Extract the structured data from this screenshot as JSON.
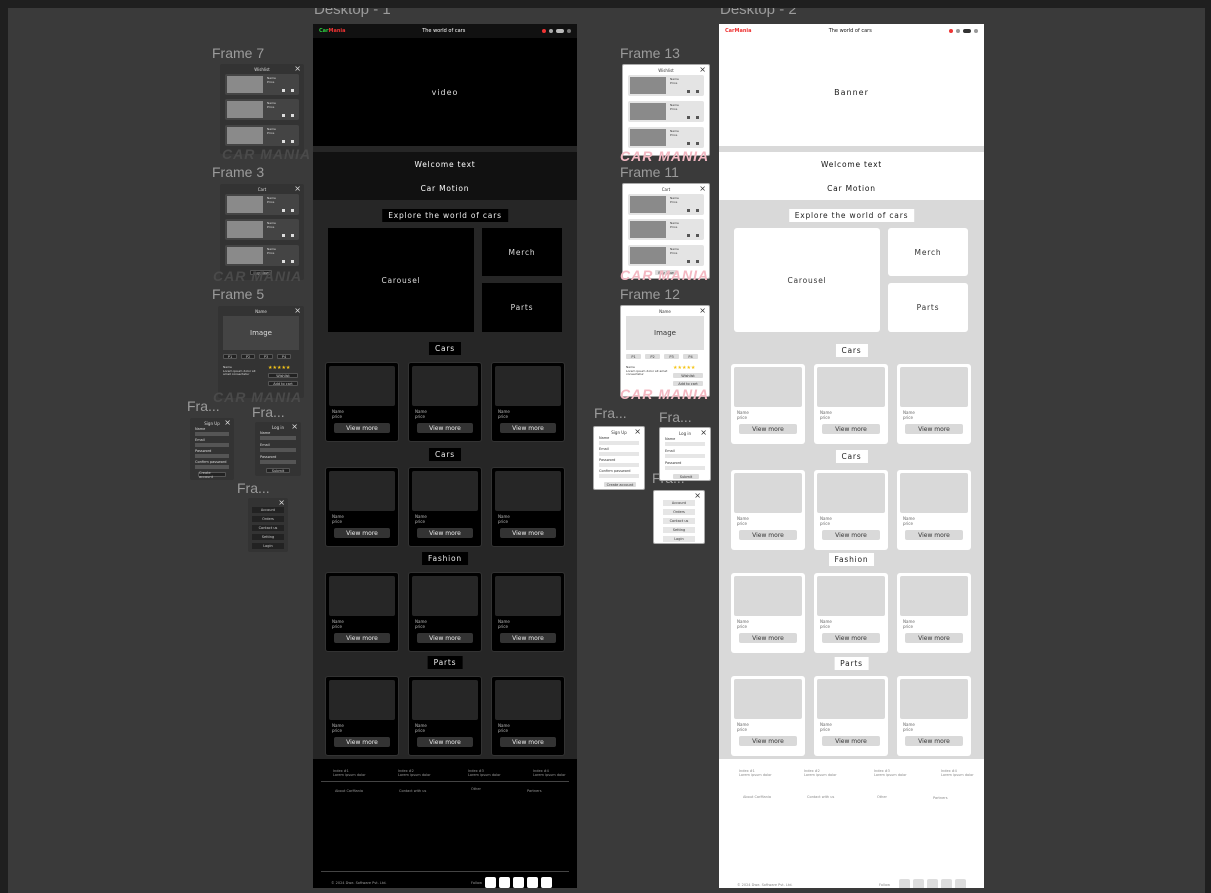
{
  "desktops": {
    "d1": {
      "label": "Desktop - 1"
    },
    "d2": {
      "label": "Desktop - 2"
    }
  },
  "topbar": {
    "logo_a": "Car",
    "logo_b": "Mania",
    "tagline": "The world of cars"
  },
  "hero": {
    "d1": "video",
    "d2": "Banner"
  },
  "welcome": {
    "text": "Welcome text",
    "sub": "Car Motion"
  },
  "explore": "Explore the world of cars",
  "tiles": {
    "carousel": "Carousel",
    "merch": "Merch",
    "parts": "Parts"
  },
  "sections": [
    "Cars",
    "Cars",
    "Fashion",
    "Parts"
  ],
  "card": {
    "name": "Name",
    "price": "price",
    "button": "View more"
  },
  "footer": {
    "cols": [
      {
        "title": "Index #1",
        "sub": "Lorem ipsum dolor"
      },
      {
        "title": "Index #2",
        "sub": "Lorem ipsum dolor"
      },
      {
        "title": "Index #3",
        "sub": "Lorem ipsum dolor"
      },
      {
        "title": "Index #4",
        "sub": "Lorem ipsum dolor"
      }
    ],
    "links": [
      "About CarMania",
      "Contact with us",
      "Other",
      "Partners"
    ],
    "copyright": "© 2024 Dwe. Software Pvt. Ltd.",
    "follow": "Follow"
  },
  "frames": {
    "f7": "Frame 7",
    "f3": "Frame 3",
    "f5": "Frame 5",
    "f13": "Frame 13",
    "f11": "Frame 11",
    "f12": "Frame 12",
    "fra": "Fra..."
  },
  "watermark": "CAR MANIA",
  "popups": {
    "wishlist": "Wishlist",
    "cart": "Cart",
    "item_name": "Name",
    "item_price": "Price",
    "buy_now": "Buy Now",
    "product": "Name",
    "image": "Image",
    "thumbs": [
      "P1",
      "P2",
      "P3",
      "P4"
    ],
    "wishlist_btn": "Wishlist",
    "add_to_cart": "Add to cart",
    "desc": "Lorem ipsum dolor sit amet consectetur",
    "signup": {
      "title": "Sign Up",
      "name": "Name",
      "email": "Email",
      "password": "Password",
      "confirm": "Confirm password",
      "btn": "Create account"
    },
    "login": {
      "title": "Log in",
      "name": "Name",
      "email": "Email",
      "password": "Password",
      "btn": "Submit"
    },
    "menu": [
      "Account",
      "Orders",
      "Contact us",
      "Setting",
      "Login"
    ]
  }
}
